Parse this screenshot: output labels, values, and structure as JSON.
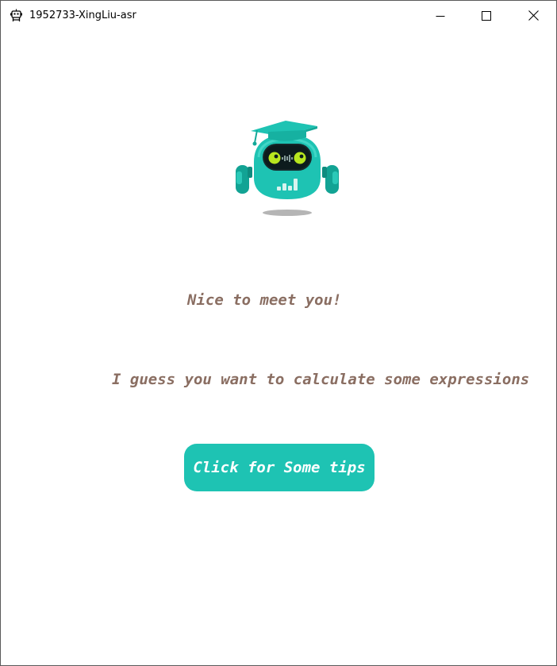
{
  "window": {
    "title": "1952733-XingLiu-asr",
    "app_icon": "robot-icon",
    "controls": {
      "minimize_icon": "minimize-icon",
      "maximize_icon": "maximize-icon",
      "close_icon": "close-icon"
    }
  },
  "main": {
    "mascot": "robot-graduate-icon",
    "greeting": "Nice to meet you!",
    "prompt": "I guess you want to calculate some expressions",
    "tips_button_label": "Click for Some tips"
  },
  "colors": {
    "accent": "#1ec3b3",
    "text": "#8a6e62",
    "robot_eye": "#b8e61f"
  }
}
